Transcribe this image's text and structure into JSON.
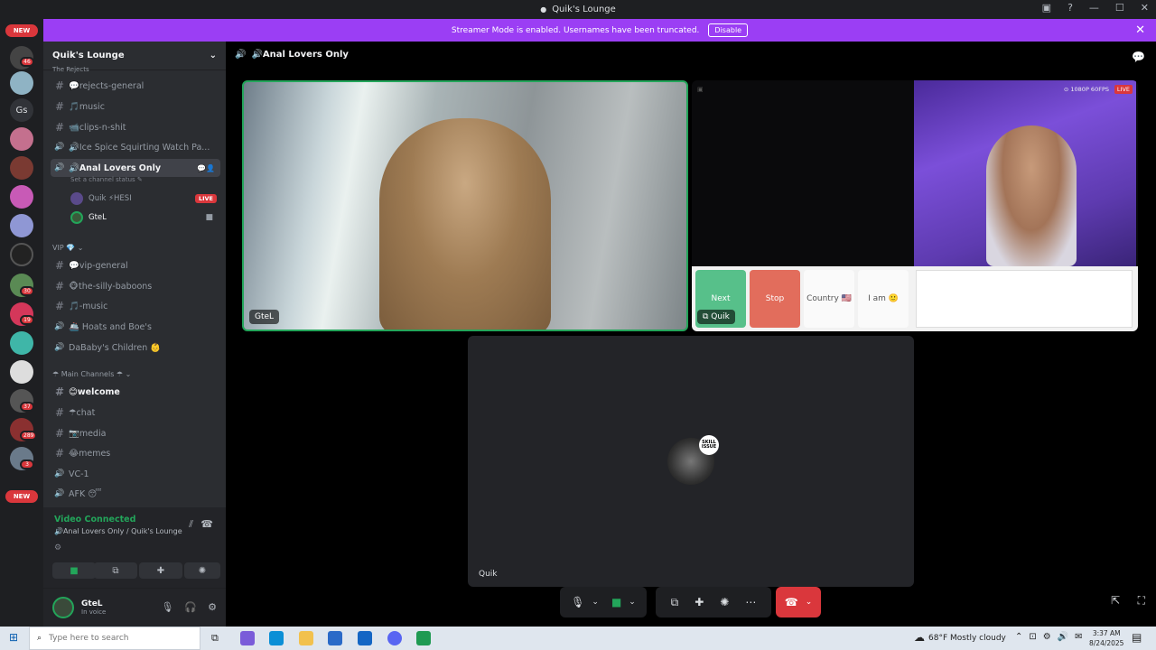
{
  "window": {
    "title": "Quik's Lounge"
  },
  "banner": {
    "text": "Streamer Mode is enabled. Usernames have been truncated.",
    "disable_label": "Disable"
  },
  "guilds": {
    "new_label": "NEW",
    "gs_label": "Gs",
    "badges": [
      "46",
      "30",
      "19",
      "37",
      "289",
      "3"
    ]
  },
  "server": {
    "name": "Quik's Lounge",
    "top_category": "The Rejects"
  },
  "channels": [
    {
      "icon": "#",
      "name": "💬rejects-general"
    },
    {
      "icon": "#",
      "name": "🎵music"
    },
    {
      "icon": "#",
      "name": "📹clips-n-shit"
    },
    {
      "icon": "🔊",
      "name": "🔊Ice Spice Squirting Watch Pa..."
    },
    {
      "icon": "🔊",
      "name": "🔊Anal Lovers Only",
      "status": "Set a channel status ✎"
    }
  ],
  "voice_users": [
    {
      "name": "Quik ⚡HESI",
      "live": "LIVE"
    },
    {
      "name": "GteL"
    }
  ],
  "vip": {
    "category": "VIP 💎",
    "channels": [
      {
        "icon": "#",
        "name": "💬vip-general"
      },
      {
        "icon": "#",
        "name": "🐵the-silly-baboons"
      },
      {
        "icon": "#",
        "name": "🎵-music"
      },
      {
        "icon": "🔊",
        "name": "🚢 Hoats and Boe's"
      },
      {
        "icon": "🔊",
        "name": "DaBaby's Children 👶"
      }
    ]
  },
  "main": {
    "category": "☂ Main Channels ☂",
    "channels": [
      {
        "icon": "#",
        "name": "😊welcome"
      },
      {
        "icon": "#",
        "name": "☂chat"
      },
      {
        "icon": "#",
        "name": "📷media"
      },
      {
        "icon": "#",
        "name": "😂memes"
      },
      {
        "icon": "🔊",
        "name": "VC-1"
      },
      {
        "icon": "🔊",
        "name": "AFK 😴"
      }
    ]
  },
  "rtc": {
    "status": "Video Connected",
    "location": "🔊Anal Lovers Only / Quik's Lounge"
  },
  "user": {
    "name": "GteL",
    "status": "In voice"
  },
  "stage": {
    "channel_name": "🔊Anal Lovers Only",
    "tile_gtel": "GteL",
    "tile_quik_stream": "Quik",
    "tile_quik": "Quik",
    "stream_quality": "⊙ 1080P 60FPS",
    "stream_live": "LIVE",
    "stream_buttons": {
      "next": "Next",
      "stop": "Stop",
      "country": "Country 🇺🇸",
      "iam": "I am 🙂"
    },
    "skill_issue": "SKILL ISSUE"
  },
  "taskbar": {
    "search_placeholder": "Type here to search",
    "weather": "68°F  Mostly cloudy",
    "time": "3:37 AM",
    "date": "8/24/2025"
  },
  "colors": {
    "accent": "#9b3ef4",
    "green": "#23a55a",
    "red": "#da373c",
    "stop": "#e26d5c",
    "next": "#57c08a"
  }
}
